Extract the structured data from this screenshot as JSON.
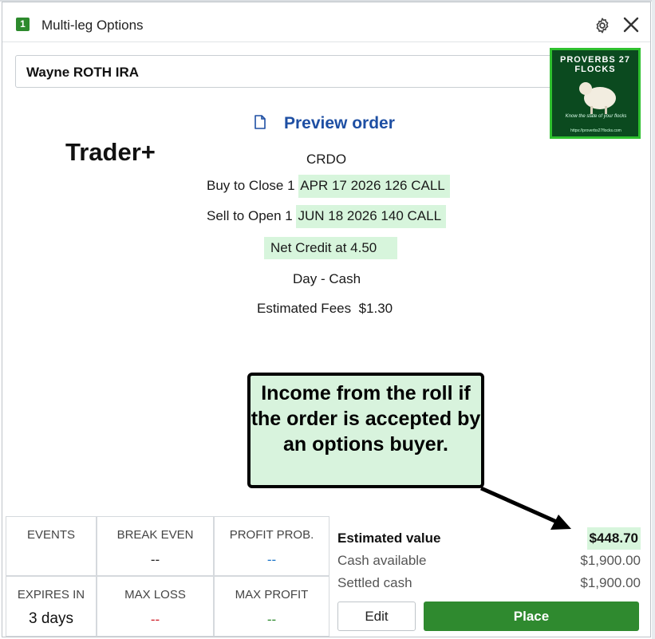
{
  "window": {
    "badge": "1",
    "title": "Multi-leg Options"
  },
  "account": {
    "name": "Wayne ROTH IRA"
  },
  "logo": {
    "text": "PROVERBS 27 FLOCKS",
    "tagline": "Know the state of your flocks",
    "url": "https://proverbs27flocks.com"
  },
  "preview": {
    "title": "Preview order"
  },
  "overlay": {
    "trader": "Trader+"
  },
  "order": {
    "symbol": "CRDO",
    "leg1_action": "Buy to Close 1",
    "leg1_contract": "APR 17 2026 126 CALL",
    "leg2_action": "Sell to Open 1",
    "leg2_contract": "JUN 18 2026 140 CALL",
    "net": "Net Credit at 4.50",
    "duration": "Day - Cash",
    "fees_label": "Estimated Fees",
    "fees_value": "$1.30"
  },
  "callout": {
    "text": "Income from the roll if the order is accepted by an options buyer."
  },
  "stats": {
    "events_label": "EVENTS",
    "break_even_label": "BREAK EVEN",
    "break_even_value": "--",
    "profit_prob_label": "PROFIT PROB.",
    "profit_prob_value": "--",
    "expires_label": "EXPIRES IN",
    "expires_value": "3 days",
    "max_loss_label": "MAX LOSS",
    "max_loss_value": "--",
    "max_profit_label": "MAX PROFIT",
    "max_profit_value": "--"
  },
  "summary": {
    "estimated_label": "Estimated value",
    "estimated_value": "$448.70",
    "cash_label": "Cash available",
    "cash_value": "$1,900.00",
    "settled_label": "Settled cash",
    "settled_value": "$1,900.00"
  },
  "buttons": {
    "edit": "Edit",
    "place": "Place"
  },
  "colors": {
    "brand_green": "#2f8a2f",
    "highlight": "#d7f5dc",
    "link_blue": "#1e4fa3"
  }
}
